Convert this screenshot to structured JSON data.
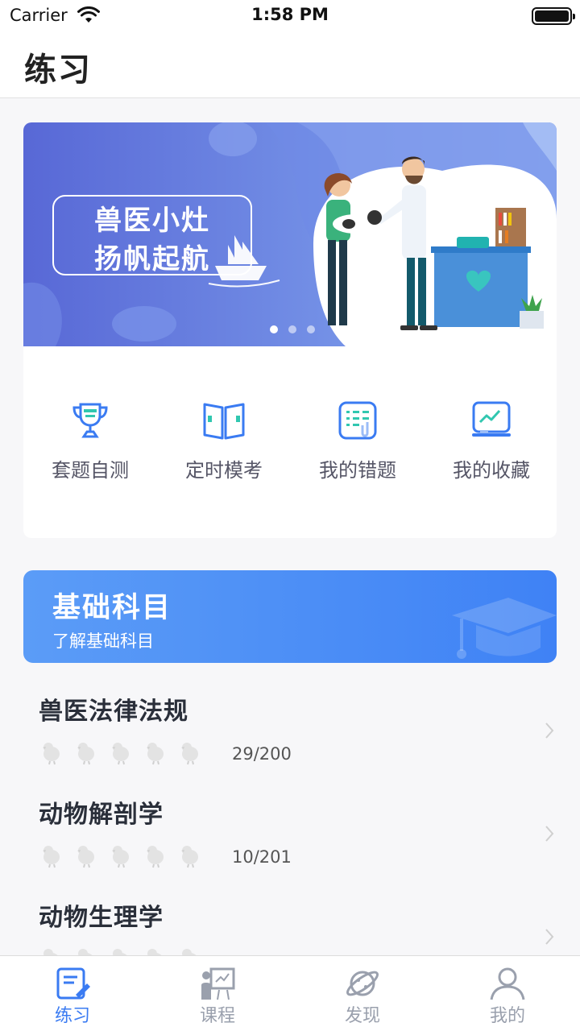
{
  "status_bar": {
    "carrier": "Carrier",
    "time": "1:58 PM"
  },
  "nav": {
    "title": "练习"
  },
  "banner": {
    "line1": "兽医小灶",
    "line2": "扬帆起航",
    "page_count": 3,
    "active_page": 1
  },
  "quick_actions": [
    {
      "label": "套题自测",
      "icon": "trophy-icon"
    },
    {
      "label": "定时模考",
      "icon": "book-icon"
    },
    {
      "label": "我的错题",
      "icon": "worksheet-icon"
    },
    {
      "label": "我的收藏",
      "icon": "chart-board-icon"
    }
  ],
  "subject": {
    "title": "基础科目",
    "subtitle": "了解基础科目"
  },
  "courses": [
    {
      "name": "兽医法律法规",
      "progress": "29/200",
      "stars": 5
    },
    {
      "name": "动物解剖学",
      "progress": "10/201",
      "stars": 5
    },
    {
      "name": "动物生理学",
      "progress": "",
      "stars": 5
    }
  ],
  "tabs": [
    {
      "label": "练习",
      "icon": "practice-icon",
      "active": true
    },
    {
      "label": "课程",
      "icon": "course-icon",
      "active": false
    },
    {
      "label": "发现",
      "icon": "planet-icon",
      "active": false
    },
    {
      "label": "我的",
      "icon": "profile-icon",
      "active": false
    }
  ],
  "colors": {
    "accent": "#3a7bf2",
    "banner_start": "#5a6fd8",
    "banner_end": "#7da5f0",
    "inactive": "#9aa0ad"
  }
}
